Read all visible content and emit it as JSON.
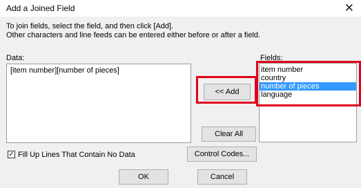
{
  "window": {
    "title": "Add a Joined Field",
    "close_glyph": "✕"
  },
  "instructions": {
    "line1": "To join fields, select the field, and then click [Add].",
    "line2": "Other characters and line feeds can be entered either before or after a field."
  },
  "data_label": "Data:",
  "data_content": "[item number][number of pieces]",
  "fields_label": "Fields:",
  "fields": [
    {
      "label": "item number",
      "selected": false
    },
    {
      "label": "country",
      "selected": false
    },
    {
      "label": "number of pieces",
      "selected": true
    },
    {
      "label": "language",
      "selected": false
    }
  ],
  "buttons": {
    "add": "<< Add",
    "clear_all": "Clear All",
    "control_codes": "Control Codes...",
    "ok": "OK",
    "cancel": "Cancel"
  },
  "checkbox": {
    "label": "Fill Up Lines That Contain No Data",
    "checked": true,
    "check_glyph": "✓"
  },
  "colors": {
    "highlight": "#e0001a",
    "selection": "#3399ff"
  }
}
